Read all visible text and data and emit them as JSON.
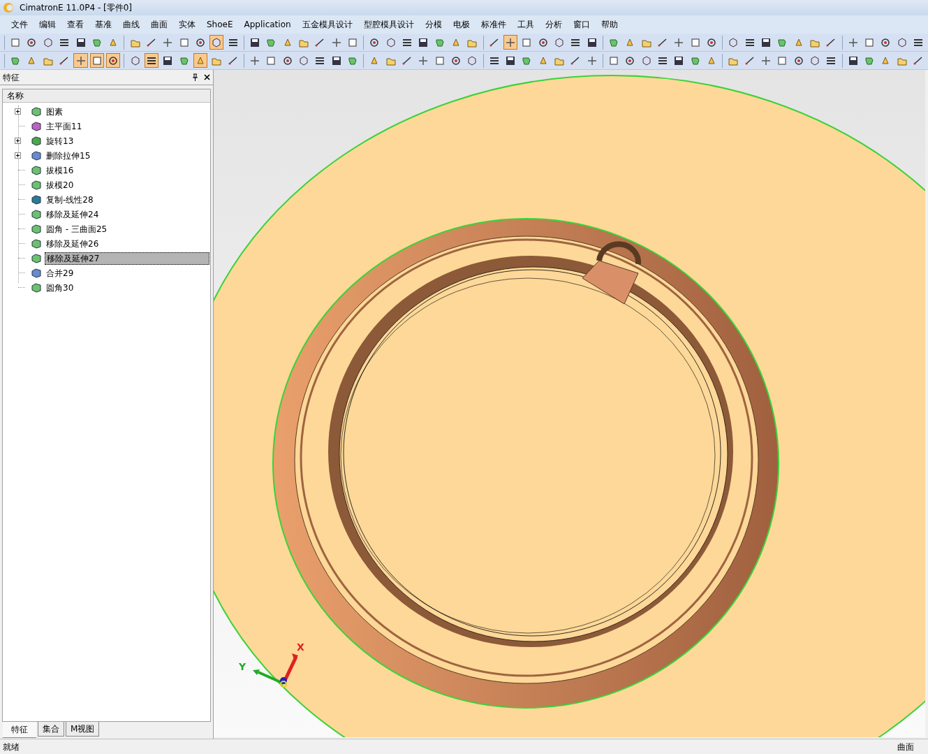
{
  "window": {
    "title": "CimatronE 11.0P4 - [零件0]"
  },
  "menu": [
    "文件",
    "编辑",
    "查看",
    "基准",
    "曲线",
    "曲面",
    "实体",
    "ShoeE",
    "Application",
    "五金模具设计",
    "型腔模具设计",
    "分模",
    "电极",
    "标准件",
    "工具",
    "分析",
    "窗口",
    "帮助"
  ],
  "panel": {
    "title": "特征",
    "column": "名称",
    "tree": [
      {
        "label": "图素",
        "expandable": true,
        "selected": false
      },
      {
        "label": "主平面11",
        "expandable": false,
        "selected": false
      },
      {
        "label": "旋转13",
        "expandable": true,
        "selected": false
      },
      {
        "label": "删除拉伸15",
        "expandable": true,
        "selected": false
      },
      {
        "label": "拔模16",
        "expandable": false,
        "selected": false
      },
      {
        "label": "拔模20",
        "expandable": false,
        "selected": false
      },
      {
        "label": "复制-线性28",
        "expandable": false,
        "selected": false
      },
      {
        "label": "移除及延伸24",
        "expandable": false,
        "selected": false
      },
      {
        "label": "圆角 - 三曲面25",
        "expandable": false,
        "selected": false
      },
      {
        "label": "移除及延伸26",
        "expandable": false,
        "selected": false
      },
      {
        "label": "移除及延伸27",
        "expandable": false,
        "selected": true
      },
      {
        "label": "合并29",
        "expandable": false,
        "selected": false
      },
      {
        "label": "圆角30",
        "expandable": false,
        "selected": false
      }
    ],
    "tabs": [
      {
        "label": "特征",
        "selected": true
      },
      {
        "label": "集合",
        "selected": false
      },
      {
        "label": "M视图",
        "selected": false
      }
    ]
  },
  "viewport": {
    "axes": {
      "x": "X",
      "y": "Y"
    }
  },
  "status_bar": {
    "message": "就绪",
    "mode": "曲面"
  }
}
